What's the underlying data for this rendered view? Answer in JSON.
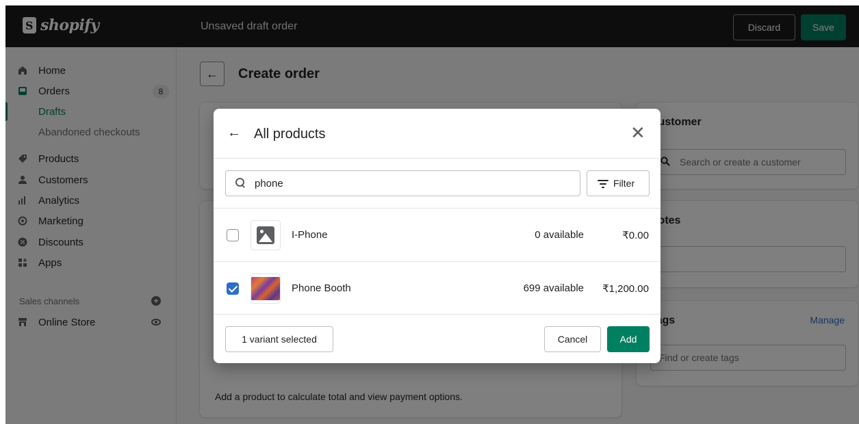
{
  "app": {
    "logo_text": "shopify",
    "title": "Unsaved draft order"
  },
  "topbar": {
    "discard_label": "Discard",
    "save_label": "Save"
  },
  "sidebar": {
    "items": [
      {
        "label": "Home",
        "icon": "home-icon"
      },
      {
        "label": "Orders",
        "icon": "orders-icon",
        "badge": "8"
      },
      {
        "label": "Drafts",
        "active": true
      },
      {
        "label": "Abandoned checkouts"
      },
      {
        "label": "Products",
        "icon": "tag-icon"
      },
      {
        "label": "Customers",
        "icon": "person-icon"
      },
      {
        "label": "Analytics",
        "icon": "bar-chart-icon"
      },
      {
        "label": "Marketing",
        "icon": "target-icon"
      },
      {
        "label": "Discounts",
        "icon": "discount-icon"
      },
      {
        "label": "Apps",
        "icon": "apps-icon"
      }
    ],
    "sales_channels_label": "Sales channels",
    "online_store_label": "Online Store"
  },
  "page": {
    "title": "Create order"
  },
  "customer_card": {
    "title": "Customer",
    "search_placeholder": "Search or create a customer"
  },
  "notes_card": {
    "title": "Notes"
  },
  "tags_card": {
    "title": "Tags",
    "manage_label": "Manage",
    "placeholder": "Find or create tags"
  },
  "payment_card": {
    "text": "Add a product to calculate total and view payment options."
  },
  "modal": {
    "title": "All products",
    "search_value": "phone",
    "filter_label": "Filter",
    "products": [
      {
        "name": "I-Phone",
        "available": "0 available",
        "price": "₹0.00",
        "checked": false
      },
      {
        "name": "Phone Booth",
        "available": "699 available",
        "price": "₹1,200.00",
        "checked": true
      }
    ],
    "selected_label": "1 variant selected",
    "cancel_label": "Cancel",
    "add_label": "Add"
  },
  "colors": {
    "primary": "#008060",
    "checkbox": "#2c6ecb",
    "link": "#2c6ecb",
    "topbar": "#1a1a1a"
  }
}
